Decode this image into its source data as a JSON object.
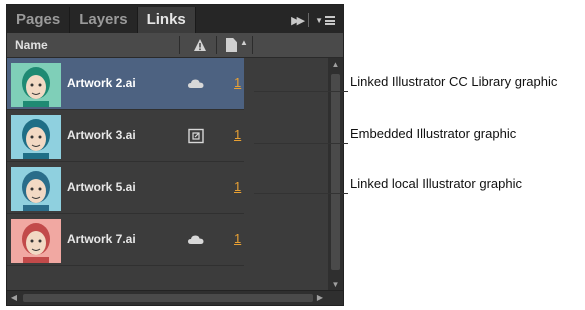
{
  "panel": {
    "tabs": [
      "Pages",
      "Layers",
      "Links"
    ],
    "active_tab": "Links",
    "column_header": "Name",
    "icons": {
      "expand": "fast-forward-icon",
      "menu": "panel-menu-icon",
      "warning": "warning-triangle-icon",
      "page": "page-icon"
    }
  },
  "rows": [
    {
      "name": "Artwork 2.ai",
      "status": "cloud-icon",
      "page": "1",
      "selected": true,
      "face": "#1f8a73",
      "bg": "#7fcfb8"
    },
    {
      "name": "Artwork 3.ai",
      "status": "embedded-icon",
      "page": "1",
      "selected": false,
      "face": "#1f6e86",
      "bg": "#8fd0df"
    },
    {
      "name": "Artwork 5.ai",
      "status": "",
      "page": "1",
      "selected": false,
      "face": "#2a6d8a",
      "bg": "#8fd0df"
    },
    {
      "name": "Artwork 7.ai",
      "status": "cloud-icon",
      "page": "1",
      "selected": false,
      "face": "#c24a4a",
      "bg": "#f1a8a2"
    }
  ],
  "callouts": {
    "c1": "Linked Illustrator CC Library graphic",
    "c2": "Embedded Illustrator graphic",
    "c3": "Linked local Illustrator graphic"
  },
  "colors": {
    "panel_bg": "#3c3c3c",
    "selected_row": "#4d6281",
    "page_link": "#e8a033"
  }
}
